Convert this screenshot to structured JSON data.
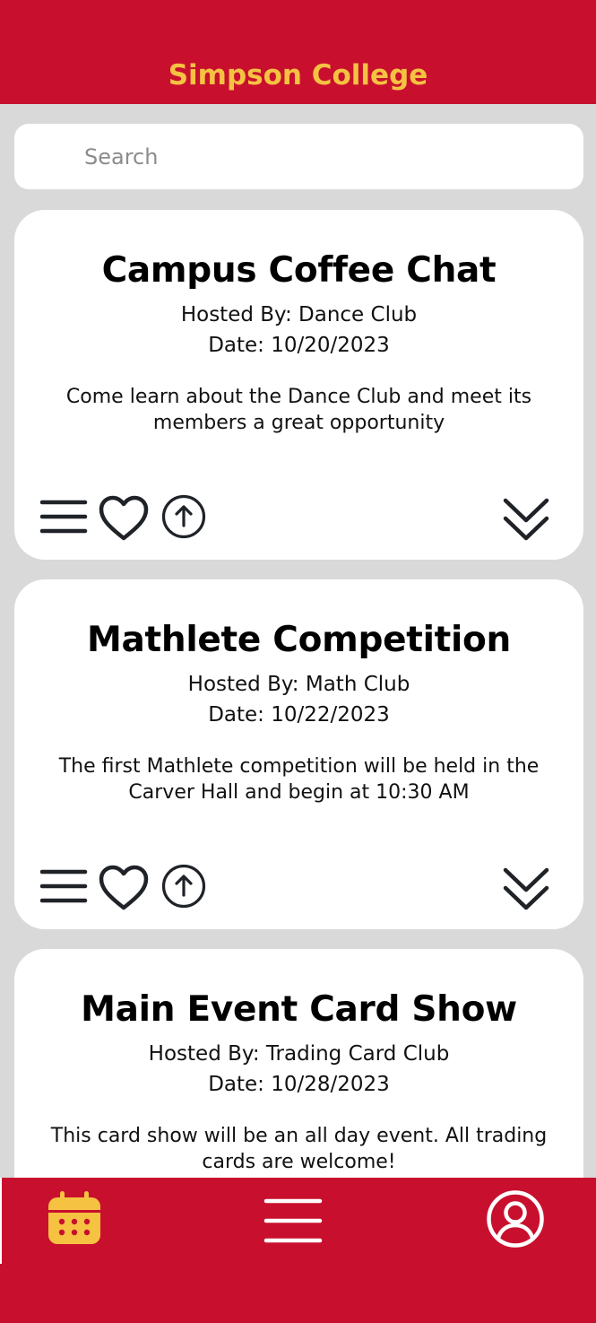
{
  "app": {
    "title": "Simpson College"
  },
  "search": {
    "placeholder": "Search",
    "value": ""
  },
  "events": [
    {
      "title": "Campus Coffee Chat",
      "hosted_by": "Hosted By: Dance Club",
      "date": "Date: 10/20/2023",
      "description": "Come learn about the Dance Club and meet its members a great opportunity"
    },
    {
      "title": "Mathlete Competition",
      "hosted_by": "Hosted By: Math Club",
      "date": "Date: 10/22/2023",
      "description": "The first Mathlete competition will be held in the Carver Hall and begin at 10:30 AM"
    },
    {
      "title": "Main Event Card Show",
      "hosted_by": "Hosted By: Trading Card Club",
      "date": "Date: 10/28/2023",
      "description": "This card show will be an all day event. All trading cards are welcome!"
    }
  ],
  "card_actions": {
    "icons": [
      "menu-icon",
      "heart-icon",
      "share-up-arrow-icon",
      "double-chevron-down-icon"
    ]
  },
  "bottom_nav": {
    "items": [
      "calendar-icon",
      "menu-icon",
      "profile-icon"
    ]
  },
  "colors": {
    "brand_red": "#c8102e",
    "brand_gold": "#f5c242",
    "background": "#d9d9d9",
    "card": "#ffffff",
    "icon_dark": "#1f2328"
  }
}
